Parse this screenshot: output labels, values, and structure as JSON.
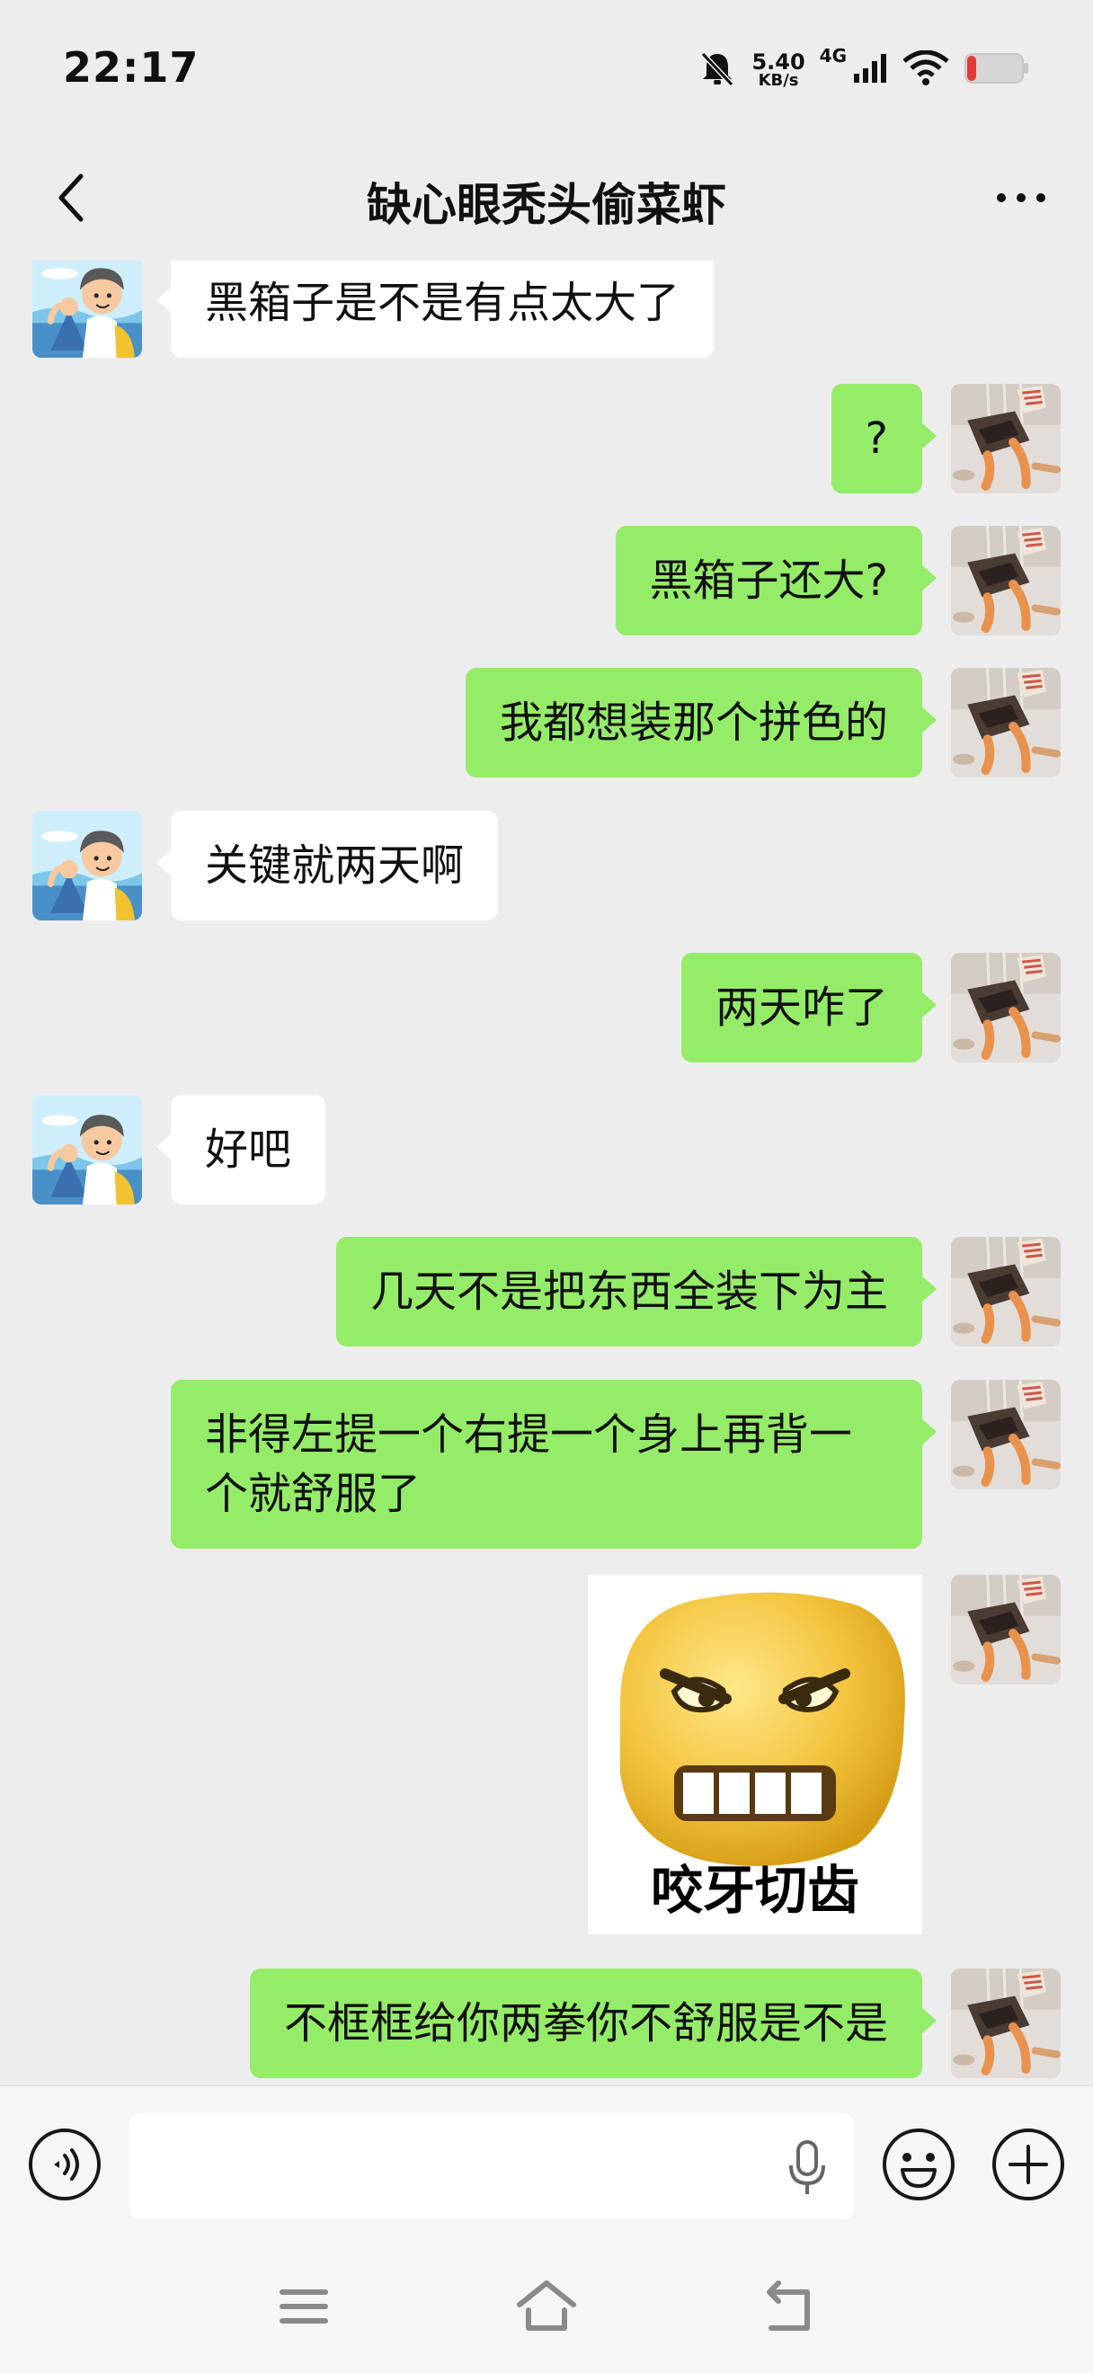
{
  "status_bar": {
    "time": "22:17",
    "net_speed_value": "5.40",
    "net_speed_unit": "KB/s",
    "network_type": "4G",
    "icons": [
      "mute-bell-icon",
      "signal-icon",
      "wifi-icon",
      "battery-low-icon"
    ],
    "battery_color": "#e53935"
  },
  "header": {
    "title": "缺心眼秃头偷菜虾",
    "back_icon": "chevron-left-icon",
    "more_icon": "more-dots-icon"
  },
  "messages": [
    {
      "side": "left",
      "text": "黑箱子是不是有点太大了"
    },
    {
      "side": "right",
      "text": "?"
    },
    {
      "side": "right",
      "text": "黑箱子还大?"
    },
    {
      "side": "right",
      "text": "我都想装那个拼色的"
    },
    {
      "side": "left",
      "text": "关键就两天啊"
    },
    {
      "side": "right",
      "text": "两天咋了"
    },
    {
      "side": "left",
      "text": "好吧"
    },
    {
      "side": "right",
      "text": "几天不是把东西全装下为主"
    },
    {
      "side": "right",
      "text": "非得左提一个右提一个身上再背一个就舒服了"
    },
    {
      "side": "right",
      "type": "sticker",
      "caption": "咬牙切齿",
      "icon": "angry-face-sticker"
    },
    {
      "side": "right",
      "text": "不框框给你两拳你不舒服是不是"
    }
  ],
  "input_bar": {
    "text_value": "",
    "icons": [
      "voice-icon",
      "mic-icon",
      "emoji-icon",
      "plus-icon"
    ]
  },
  "nav_bar": {
    "icons": [
      "menu-icon",
      "home-icon",
      "back-nav-icon"
    ]
  },
  "colors": {
    "outgoing_bubble": "#95ec69",
    "incoming_bubble": "#ffffff",
    "background": "#ededed"
  }
}
